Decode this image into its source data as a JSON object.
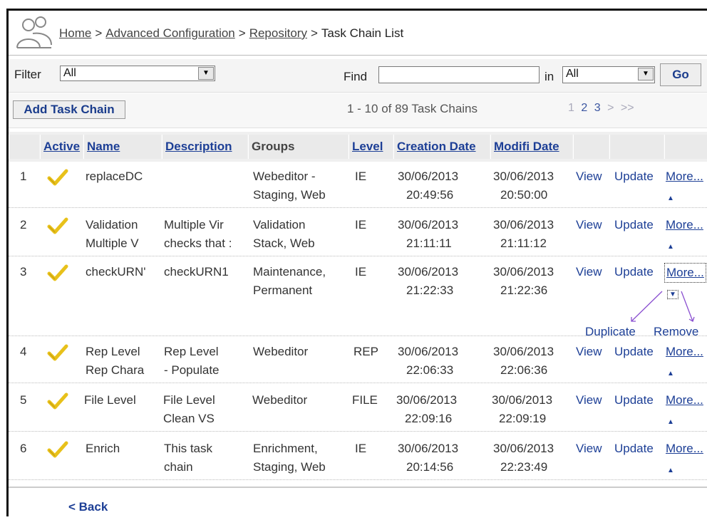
{
  "breadcrumb": {
    "home": "Home",
    "advanced": "Advanced Configuration",
    "repository": "Repository",
    "current": "Task Chain List",
    "separator": ">"
  },
  "filter": {
    "label": "Filter",
    "value": "All",
    "find_label": "Find",
    "find_value": "",
    "in_label": "in",
    "in_value": "All",
    "go_label": "Go"
  },
  "actions": {
    "add_label": "Add Task Chain",
    "count_text": "1 - 10 of 89 Task Chains",
    "pages": [
      "1",
      "2",
      "3"
    ],
    "next": ">",
    "last": ">>"
  },
  "columns": {
    "active": "Active",
    "name": "Name",
    "description": "Description",
    "groups": "Groups",
    "level": "Level",
    "creation": "Creation Date",
    "modified": "Modifi Date"
  },
  "rows": [
    {
      "num": "1",
      "name1": "replaceDC",
      "name2": "",
      "desc1": "",
      "desc2": "",
      "grp1": "Webeditor -",
      "grp2": "Staging, Web",
      "level": "IE",
      "cdate": "30/06/2013",
      "ctime": "20:49:56",
      "mdate": "30/06/2013",
      "mtime": "20:50:00",
      "view": "View",
      "update": "Update",
      "more": "More..."
    },
    {
      "num": "2",
      "name1": "Validation",
      "name2": "Multiple V",
      "desc1": "Multiple Vir",
      "desc2": "checks that :",
      "grp1": "Validation",
      "grp2": "Stack, Web",
      "level": "IE",
      "cdate": "30/06/2013",
      "ctime": "21:11:11",
      "mdate": "30/06/2013",
      "mtime": "21:11:12",
      "view": "View",
      "update": "Update",
      "more": "More..."
    },
    {
      "num": "3",
      "name1": "checkURN'",
      "name2": "",
      "desc1": "checkURN1",
      "desc2": "",
      "grp1": "Maintenance,",
      "grp2": "Permanent",
      "level": "IE",
      "cdate": "30/06/2013",
      "ctime": "21:22:33",
      "mdate": "30/06/2013",
      "mtime": "21:22:36",
      "view": "View",
      "update": "Update",
      "more": "More..."
    },
    {
      "num": "4",
      "name1": "Rep Level",
      "name2": "Rep Chara",
      "desc1": "Rep Level",
      "desc2": "- Populate",
      "grp1": "Webeditor",
      "grp2": "",
      "level": "REP",
      "cdate": "30/06/2013",
      "ctime": "22:06:33",
      "mdate": "30/06/2013",
      "mtime": "22:06:36",
      "view": "View",
      "update": "Update",
      "more": "More..."
    },
    {
      "num": "5",
      "name1": "File Level",
      "name2": "",
      "desc1": "File Level",
      "desc2": "Clean VS",
      "grp1": "Webeditor",
      "grp2": "",
      "level": "FILE",
      "cdate": "30/06/2013",
      "ctime": "22:09:16",
      "mdate": "30/06/2013",
      "mtime": "22:09:19",
      "view": "View",
      "update": "Update",
      "more": "More..."
    },
    {
      "num": "6",
      "name1": "Enrich",
      "name2": "",
      "desc1": "This task",
      "desc2": "chain",
      "grp1": "Enrichment,",
      "grp2": "Staging, Web",
      "level": "IE",
      "cdate": "30/06/2013",
      "ctime": "20:14:56",
      "mdate": "30/06/2013",
      "mtime": "22:23:49",
      "view": "View",
      "update": "Update",
      "more": "More..."
    }
  ],
  "row3_submenu": {
    "duplicate": "Duplicate",
    "remove": "Remove"
  },
  "footer": {
    "back_label": "< Back"
  },
  "colors": {
    "link": "#1d3f96",
    "check": "#e8c11a",
    "submenu_arrow": "#8a4fd0"
  }
}
